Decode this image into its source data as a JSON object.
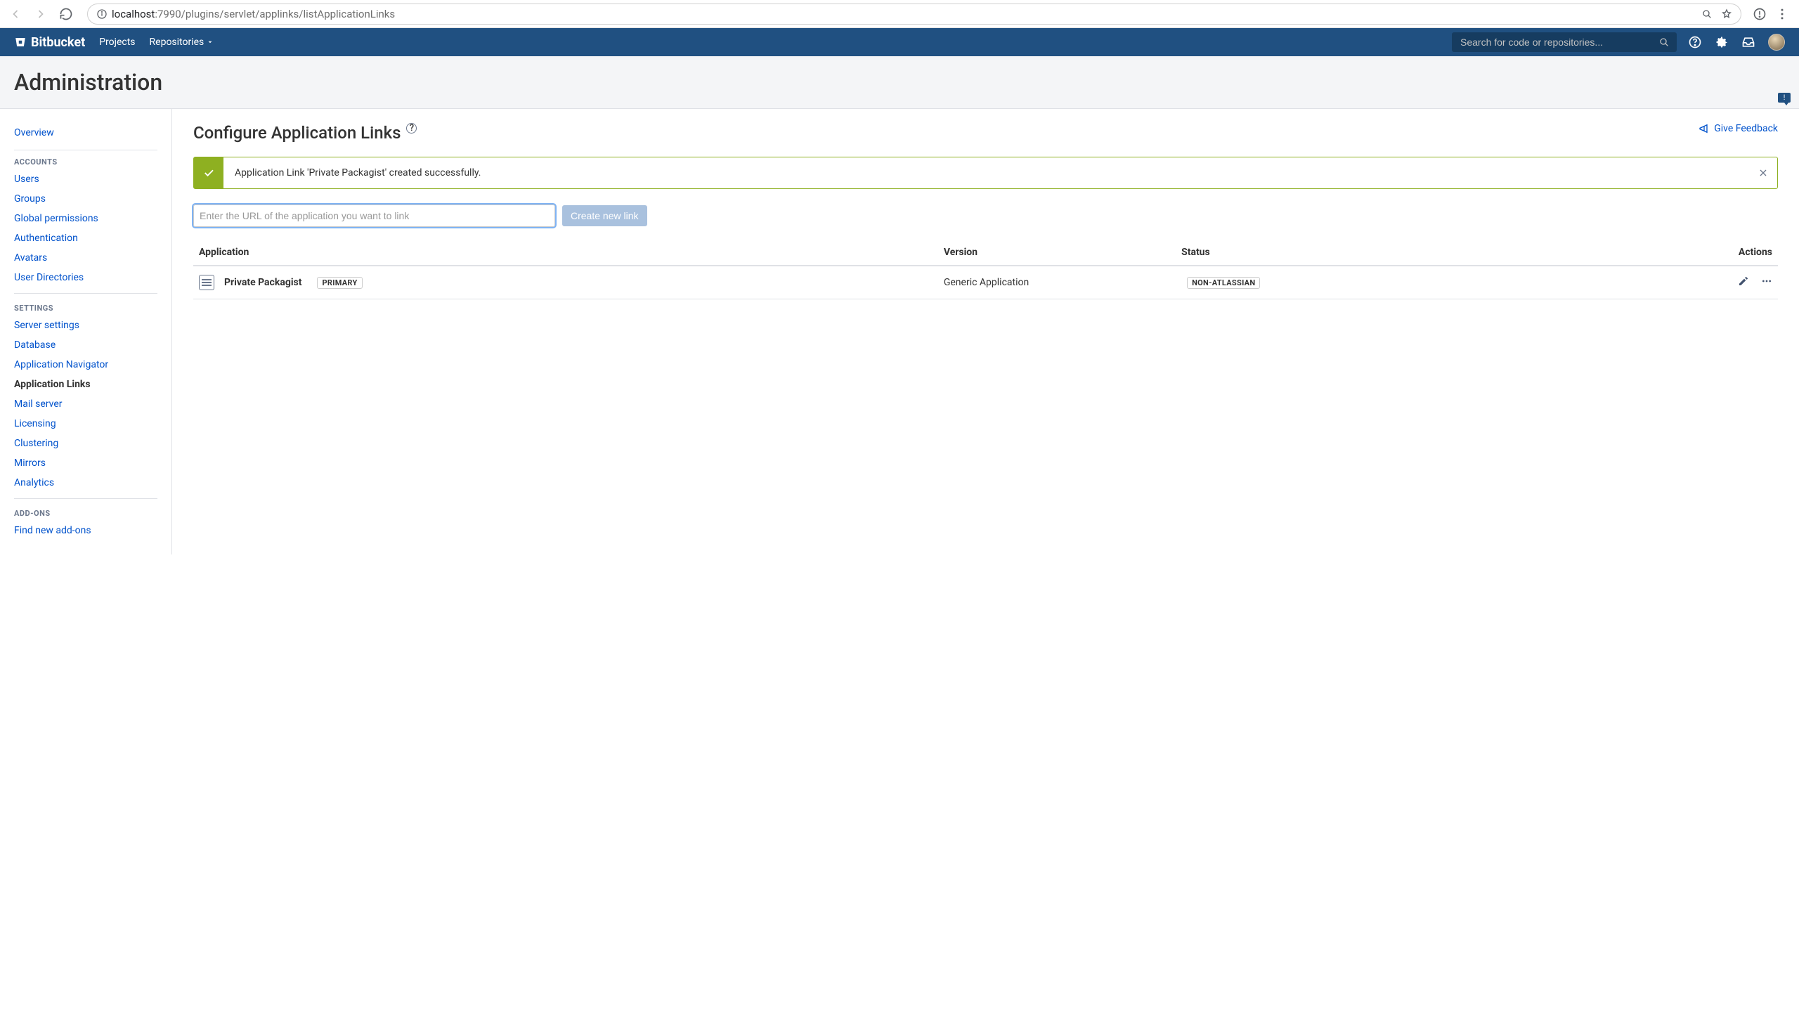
{
  "browser": {
    "url_host": "localhost",
    "url_port_path": ":7990/plugins/servlet/applinks/listApplicationLinks"
  },
  "topnav": {
    "brand": "Bitbucket",
    "links": {
      "projects": "Projects",
      "repositories": "Repositories"
    },
    "search_placeholder": "Search for code or repositories..."
  },
  "adminHeader": {
    "title": "Administration"
  },
  "sidebar": {
    "overview": "Overview",
    "sections": {
      "accounts": {
        "head": "ACCOUNTS",
        "users": "Users",
        "groups": "Groups",
        "global_permissions": "Global permissions",
        "authentication": "Authentication",
        "avatars": "Avatars",
        "user_directories": "User Directories"
      },
      "settings": {
        "head": "SETTINGS",
        "server_settings": "Server settings",
        "database": "Database",
        "app_nav": "Application Navigator",
        "app_links": "Application Links",
        "mail_server": "Mail server",
        "licensing": "Licensing",
        "clustering": "Clustering",
        "mirrors": "Mirrors",
        "analytics": "Analytics"
      },
      "addons": {
        "head": "ADD-ONS",
        "find_new": "Find new add-ons"
      }
    }
  },
  "main": {
    "title": "Configure Application Links",
    "feedback": "Give Feedback",
    "success": "Application Link 'Private Packagist' created successfully.",
    "url_placeholder": "Enter the URL of the application you want to link",
    "create_button": "Create new link",
    "table": {
      "head": {
        "application": "Application",
        "version": "Version",
        "status": "Status",
        "actions": "Actions"
      },
      "rows": [
        {
          "name": "Private Packagist",
          "primary": "PRIMARY",
          "version": "Generic Application",
          "status": "NON-ATLASSIAN"
        }
      ]
    }
  }
}
